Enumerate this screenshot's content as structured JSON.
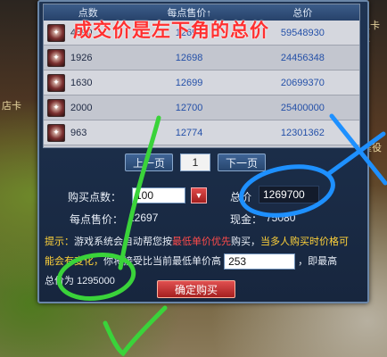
{
  "background": {
    "right_text": "上卡积",
    "left_text": "店卡",
    "right_text2": "雁役"
  },
  "market": {
    "headers": [
      "点数",
      "每点售价↑",
      "总价"
    ],
    "rows": [
      {
        "qty": "4690",
        "price": "12697",
        "total": "59548930"
      },
      {
        "qty": "1926",
        "price": "12698",
        "total": "24456348"
      },
      {
        "qty": "1630",
        "price": "12699",
        "total": "20699370"
      },
      {
        "qty": "2000",
        "price": "12700",
        "total": "25400000"
      },
      {
        "qty": "963",
        "price": "12774",
        "total": "12301362"
      }
    ],
    "icon": "item-icon"
  },
  "pager": {
    "prev_label": "上一页",
    "page": "1",
    "next_label": "下一页"
  },
  "purchase": {
    "qty_label": "购买点数：",
    "qty_value": "100",
    "total_label": "总价",
    "total_value": "1269700",
    "unit_price_label": "每点售价：",
    "unit_price_value": "12697",
    "cash_label": "现金：",
    "cash_value": "75080"
  },
  "tip": {
    "prefix": "提示：",
    "part1": "游戏系统会自动帮您按",
    "lowest_first": "最低单价优先",
    "part2": "购买，",
    "warning": "当多人购买时价格可",
    "part3": "能会有变化，",
    "part4": "你将接受比当前最低单价高",
    "max_price_value": "253",
    "part5": "，即最高",
    "total_prefix": "总价为",
    "total_value": "1295000"
  },
  "confirm_label": "确定购买",
  "annotation": {
    "text": "成交价是左下角的总价",
    "color": "#ff3030",
    "check_color": "#3ad33a",
    "circle_color": "#1e90ff"
  }
}
